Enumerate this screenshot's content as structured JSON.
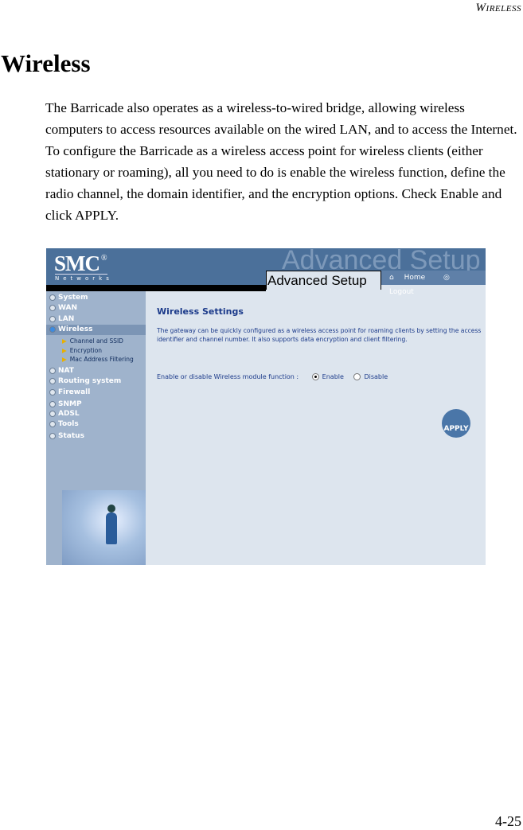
{
  "running_head": {
    "first": "W",
    "rest": "IRELESS"
  },
  "heading": "Wireless",
  "paragraph": "The Barricade also operates as a wireless-to-wired bridge, allowing wireless computers to access resources available on the wired LAN, and to access the Internet. To configure the Barricade as a wireless access point for wireless clients (either stationary or roaming), all you need to do is enable the wireless function, define the radio channel, the domain identifier, and the encryption options. Check Enable and click APPLY.",
  "screenshot": {
    "logo": "SMC",
    "logo_sub": "Networks",
    "logo_mark": "®",
    "ghost_title": "Advanced Setup",
    "tab_title": "Advanced Setup",
    "nav": {
      "home": "Home",
      "logout": "Logout"
    },
    "menu": [
      "System",
      "WAN",
      "LAN",
      "Wireless",
      "NAT",
      "Routing system",
      "Firewall",
      "SNMP",
      "ADSL",
      "Tools",
      "Status"
    ],
    "active_menu": "Wireless",
    "submenu": [
      "Channel and SSID",
      "Encryption",
      "Mac Address Filtering"
    ],
    "title": "Wireless Settings",
    "description": "The gateway can be quickly configured as a wireless access point for roaming clients by setting the access identifier and channel number. It also supports data encryption and client filtering.",
    "option_label": "Enable or disable Wireless module function :",
    "enable": "Enable",
    "disable": "Disable",
    "selected": "Enable",
    "apply": "APPLY",
    "colors": {
      "header": "#4b709a",
      "sidebar": "#9fb3cc",
      "content": "#dde5ee",
      "text": "#1b3a8a"
    }
  },
  "page_number": "4-25"
}
